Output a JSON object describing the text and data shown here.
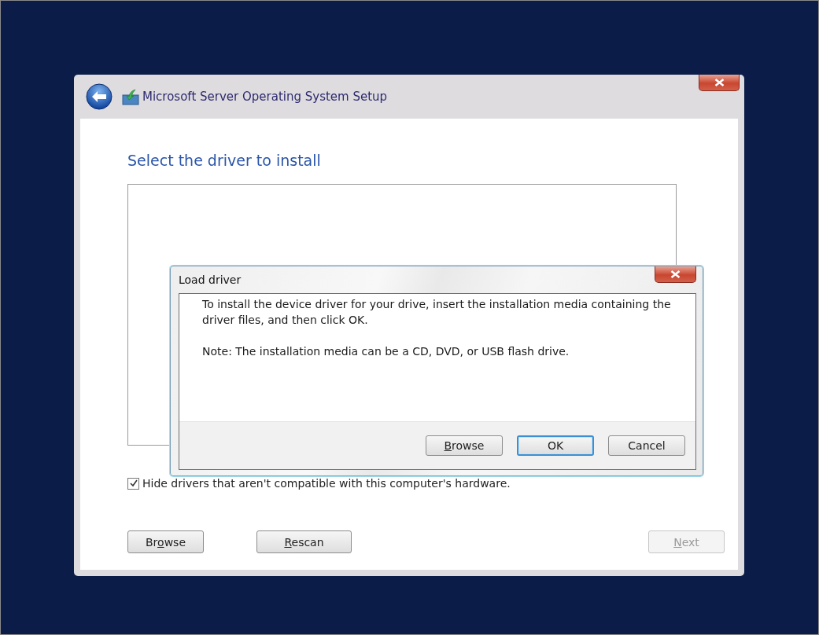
{
  "window": {
    "title": "Microsoft Server Operating System Setup"
  },
  "heading": "Select the driver to install",
  "hide_incompatible": {
    "label": "Hide drivers that aren't compatible with this computer's hardware.",
    "checked": true
  },
  "buttons": [
    {
      "before": "Br",
      "access_key": "o",
      "after": "wse",
      "disabled": false
    },
    {
      "access_key": "R",
      "after": "escan",
      "disabled": false
    },
    {
      "access_key": "N",
      "after": "ext",
      "disabled": true
    }
  ],
  "dialog": {
    "title": "Load driver",
    "paragraphs": [
      "To install the device driver for your drive, insert the installation media containing the driver files, and then click OK.",
      "Note: The installation media can be a CD, DVD, or USB flash drive."
    ],
    "buttons": [
      {
        "access_key": "B",
        "after": "rowse",
        "default": false
      },
      {
        "after": "OK",
        "default": true
      },
      {
        "after": "Cancel",
        "default": false
      }
    ]
  }
}
